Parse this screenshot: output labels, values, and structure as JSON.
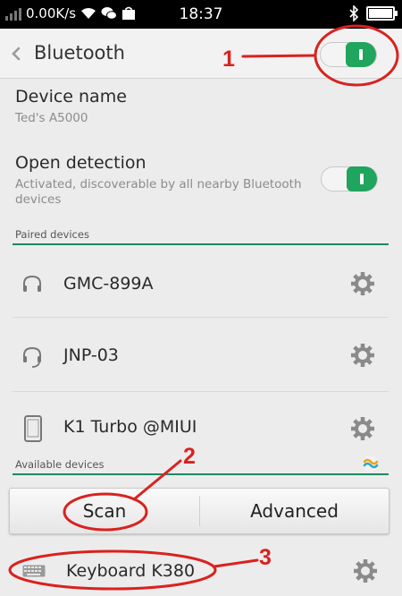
{
  "status_bar": {
    "network_speed": "0.00K/s",
    "time": "18:37"
  },
  "header": {
    "title": "Bluetooth"
  },
  "device": {
    "label": "Device name",
    "value": "Ted's A5000"
  },
  "open_detection": {
    "label": "Open detection",
    "description_line1": "Activated, discoverable by all nearby Bluetooth",
    "description_line2": "devices"
  },
  "paired": {
    "header": "Paired devices",
    "devices": [
      {
        "name": "GMC-899A",
        "icon": "headphones-icon"
      },
      {
        "name": "JNP-03",
        "icon": "headset-icon"
      },
      {
        "name": "K1 Turbo @MIUI",
        "icon": "phone-icon"
      }
    ]
  },
  "available": {
    "header": "Available devices",
    "devices": [
      {
        "name": "Keyboard K380",
        "icon": "keyboard-icon"
      }
    ]
  },
  "buttons": {
    "scan": "Scan",
    "advanced": "Advanced"
  },
  "annotations": {
    "n1": "1",
    "n2": "2",
    "n3": "3"
  },
  "colors": {
    "accent": "#1fa55d",
    "annotation": "#d9221f",
    "section_line": "#1b8a5f"
  }
}
